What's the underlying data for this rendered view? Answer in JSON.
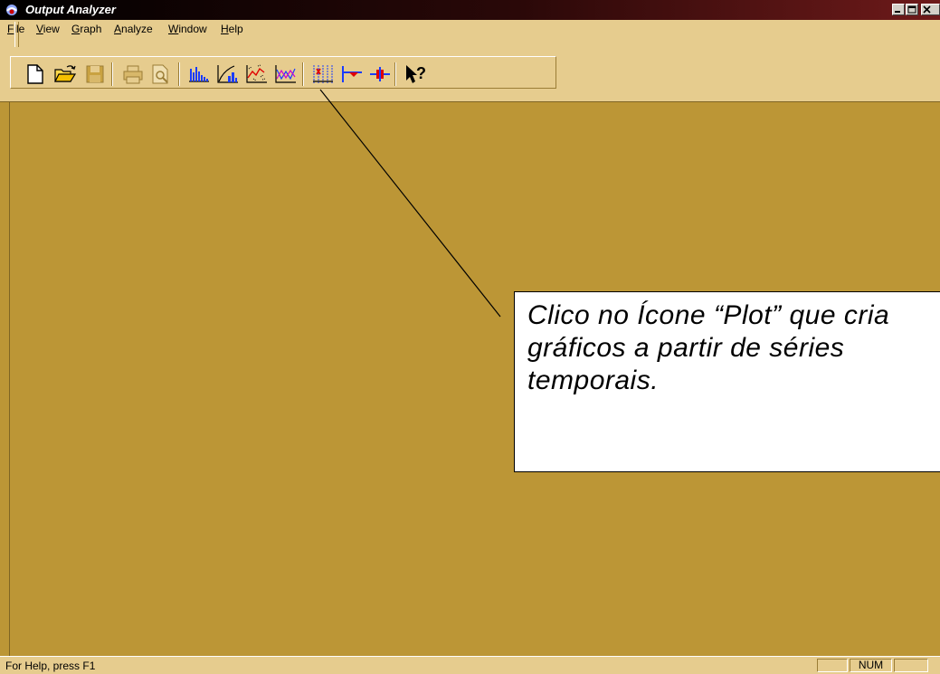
{
  "window": {
    "title": "Output Analyzer"
  },
  "menu": [
    {
      "label": "File",
      "accel": "F",
      "rest": "ile"
    },
    {
      "label": "View",
      "accel": "V",
      "rest": "iew"
    },
    {
      "label": "Graph",
      "accel": "G",
      "rest": "raph"
    },
    {
      "label": "Analyze",
      "accel": "A",
      "rest": "nalyze"
    },
    {
      "label": "Window",
      "accel": "W",
      "rest": "indow"
    },
    {
      "label": "Help",
      "accel": "H",
      "rest": "elp"
    }
  ],
  "toolbar": {
    "icons": [
      "new-file-icon",
      "open-folder-icon",
      "save-icon",
      "print-icon",
      "print-preview-icon",
      "histogram-icon",
      "bar-chart-icon",
      "plot-icon",
      "line-chart-icon",
      "intervals-icon",
      "moving-average-icon",
      "batch-means-icon",
      "context-help-icon"
    ]
  },
  "callout": {
    "text": "Clico no Ícone “Plot” que cria gráficos a partir de séries temporais."
  },
  "status": {
    "text": "For Help, press F1",
    "num": "NUM"
  },
  "colors": {
    "workspace": "#bc9636",
    "chrome": "#e6cc8e"
  }
}
